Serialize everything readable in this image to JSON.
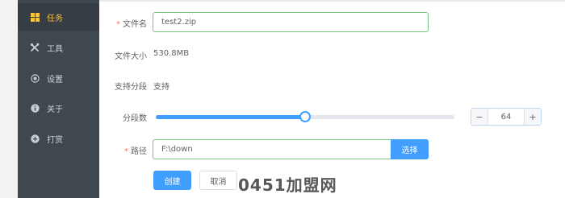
{
  "sidebar": {
    "items": [
      {
        "label": "任务",
        "icon": "grid-icon",
        "active": true
      },
      {
        "label": "工具",
        "icon": "tools-icon",
        "active": false
      },
      {
        "label": "设置",
        "icon": "settings-icon",
        "active": false
      },
      {
        "label": "关于",
        "icon": "info-icon",
        "active": false
      },
      {
        "label": "打赏",
        "icon": "coin-icon",
        "active": false
      }
    ]
  },
  "form": {
    "filename": {
      "required_mark": "*",
      "label": "文件名",
      "value": "test2.zip"
    },
    "filesize": {
      "label": "文件大小",
      "value": "530.8MB"
    },
    "split_support": {
      "label": "支持分段",
      "value": "支持"
    },
    "segments": {
      "label": "分段数",
      "value": "64",
      "slider_fraction": 0.5,
      "minus": "−",
      "plus": "+"
    },
    "path": {
      "required_mark": "*",
      "label": "路径",
      "value": "F:\\down",
      "browse_label": "选择"
    },
    "create_label": "创建",
    "cancel_label": "取消"
  },
  "watermark": "0451加盟网",
  "colors": {
    "sidebar_bg": "#3f474f",
    "active_text": "#f5c242",
    "accent": "#409eff",
    "input_border": "#7ac47f",
    "required": "#f56c6c"
  }
}
